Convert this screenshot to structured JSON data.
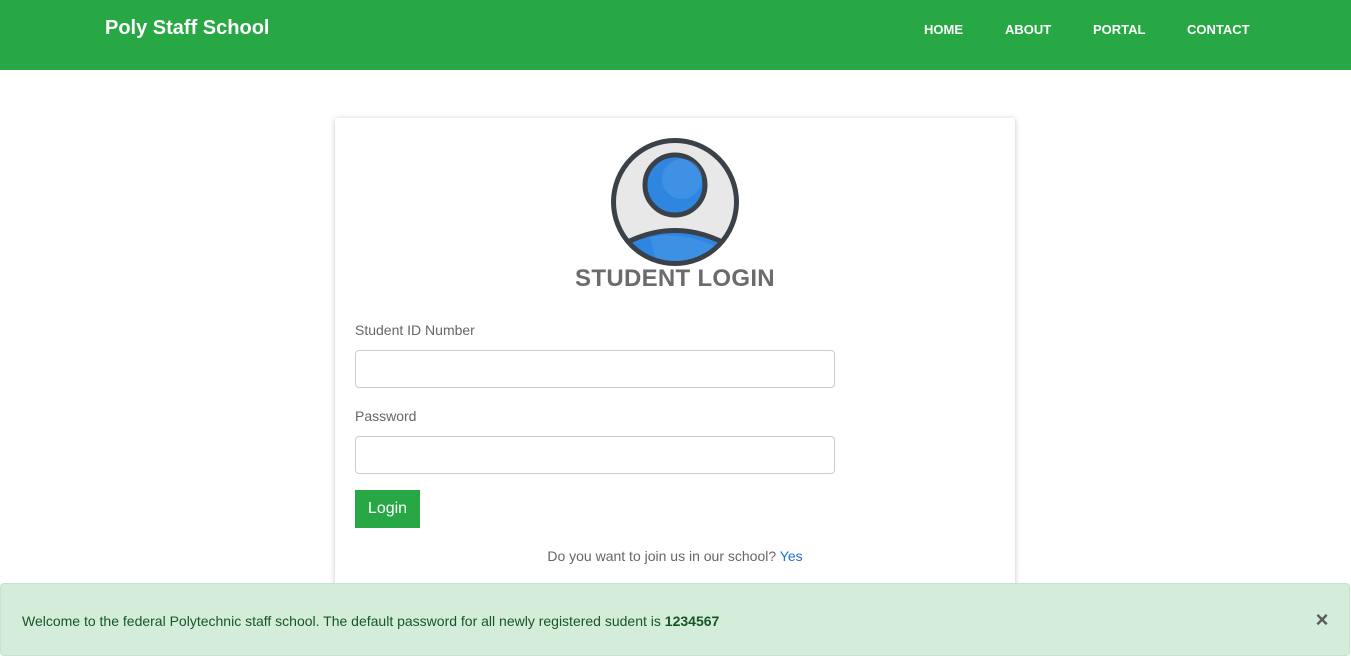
{
  "header": {
    "brand": "Poly Staff School",
    "nav": [
      "HOME",
      "ABOUT",
      "PORTAL",
      "CONTACT"
    ]
  },
  "login": {
    "title": "STUDENT LOGIN",
    "id_label": "Student ID Number",
    "id_value": "",
    "password_label": "Password",
    "password_value": "",
    "button_label": "Login",
    "join_text": "Do you want to join us in our school?",
    "join_link": "Yes"
  },
  "alert": {
    "message": "Welcome to the federal Polytechnic staff school. The default password for all newly registered sudent is",
    "password": "1234567",
    "close_symbol": "×"
  },
  "colors": {
    "brand_green": "#28a745",
    "alert_bg": "#d4edda",
    "avatar_blue": "#2f86e0"
  },
  "icons": {
    "avatar": "user-avatar-icon",
    "close": "close-icon"
  }
}
